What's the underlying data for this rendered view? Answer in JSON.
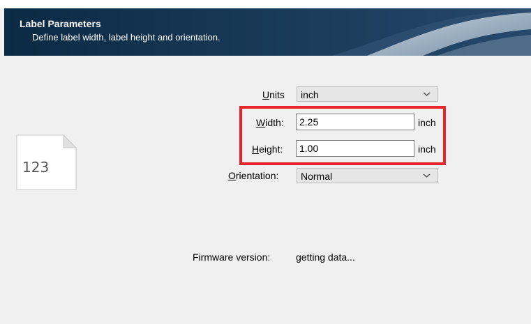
{
  "header": {
    "title": "Label Parameters",
    "subtitle": "Define label width, label height and orientation."
  },
  "form": {
    "units": {
      "label_underlined": "U",
      "label_rest": "nits",
      "value": "inch"
    },
    "width": {
      "label_underlined": "W",
      "label_rest": "idth:",
      "value": "2.25",
      "unit": "inch"
    },
    "height": {
      "label_underlined": "H",
      "label_rest": "eight:",
      "value": "1.00",
      "unit": "inch"
    },
    "orientation": {
      "label_underlined": "O",
      "label_rest": "rientation:",
      "value": "Normal"
    }
  },
  "preview_icon": {
    "text": "123",
    "icon": "label-document-icon"
  },
  "firmware": {
    "label": "Firmware version:",
    "value": "getting data..."
  },
  "colors": {
    "header_bg": "#0b2a44",
    "highlight": "#e8232a"
  }
}
